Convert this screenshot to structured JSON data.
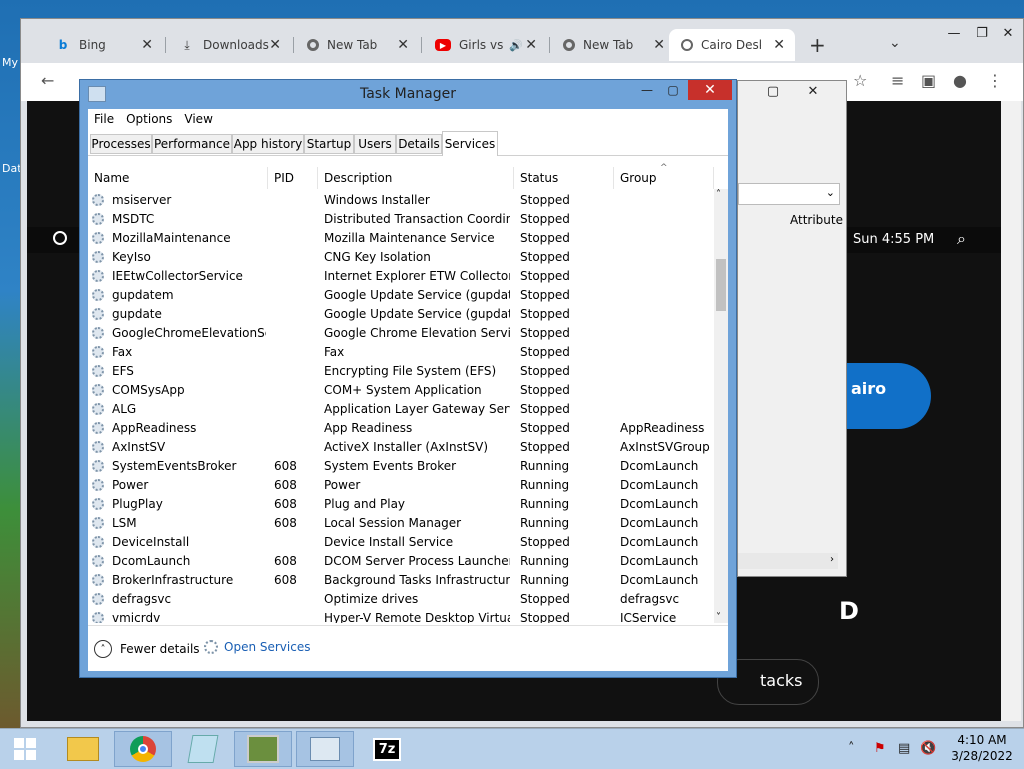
{
  "desktop": {
    "icon_labels": [
      "My",
      "Dat"
    ]
  },
  "chrome": {
    "tabs": [
      {
        "label": "Bing",
        "icon": "bing-icon"
      },
      {
        "label": "Downloads",
        "icon": "download-icon"
      },
      {
        "label": "New Tab",
        "icon": "chrome-icon"
      },
      {
        "label": "Girls vs",
        "icon": "youtube-icon"
      },
      {
        "label": "New Tab",
        "icon": "chrome-icon"
      },
      {
        "label": "Cairo Deskt",
        "icon": "cairo-icon"
      }
    ],
    "close_glyph": "✕",
    "newtab_glyph": "+",
    "page": {
      "time": "Sun 4:55 PM",
      "button_text": "airo",
      "heading_partial": "D",
      "pill_text": "tacks"
    }
  },
  "bgwindow": {
    "header_col": "Attribute"
  },
  "taskmanager": {
    "title": "Task Manager",
    "menu": [
      "File",
      "Options",
      "View"
    ],
    "tabs": [
      "Processes",
      "Performance",
      "App history",
      "Startup",
      "Users",
      "Details",
      "Services"
    ],
    "active_tab": "Services",
    "columns": [
      "Name",
      "PID",
      "Description",
      "Status",
      "Group"
    ],
    "rows": [
      {
        "name": "msiserver",
        "pid": "",
        "desc": "Windows Installer",
        "status": "Stopped",
        "group": ""
      },
      {
        "name": "MSDTC",
        "pid": "",
        "desc": "Distributed Transaction Coordin...",
        "status": "Stopped",
        "group": ""
      },
      {
        "name": "MozillaMaintenance",
        "pid": "",
        "desc": "Mozilla Maintenance Service",
        "status": "Stopped",
        "group": ""
      },
      {
        "name": "KeyIso",
        "pid": "",
        "desc": "CNG Key Isolation",
        "status": "Stopped",
        "group": ""
      },
      {
        "name": "IEEtwCollectorService",
        "pid": "",
        "desc": "Internet Explorer ETW Collector S...",
        "status": "Stopped",
        "group": ""
      },
      {
        "name": "gupdatem",
        "pid": "",
        "desc": "Google Update Service (gupdate...",
        "status": "Stopped",
        "group": ""
      },
      {
        "name": "gupdate",
        "pid": "",
        "desc": "Google Update Service (gupdate)",
        "status": "Stopped",
        "group": ""
      },
      {
        "name": "GoogleChromeElevationSer...",
        "pid": "",
        "desc": "Google Chrome Elevation Servic...",
        "status": "Stopped",
        "group": ""
      },
      {
        "name": "Fax",
        "pid": "",
        "desc": "Fax",
        "status": "Stopped",
        "group": ""
      },
      {
        "name": "EFS",
        "pid": "",
        "desc": "Encrypting File System (EFS)",
        "status": "Stopped",
        "group": ""
      },
      {
        "name": "COMSysApp",
        "pid": "",
        "desc": "COM+ System Application",
        "status": "Stopped",
        "group": ""
      },
      {
        "name": "ALG",
        "pid": "",
        "desc": "Application Layer Gateway Service",
        "status": "Stopped",
        "group": ""
      },
      {
        "name": "AppReadiness",
        "pid": "",
        "desc": "App Readiness",
        "status": "Stopped",
        "group": "AppReadiness"
      },
      {
        "name": "AxInstSV",
        "pid": "",
        "desc": "ActiveX Installer (AxInstSV)",
        "status": "Stopped",
        "group": "AxInstSVGroup"
      },
      {
        "name": "SystemEventsBroker",
        "pid": "608",
        "desc": "System Events Broker",
        "status": "Running",
        "group": "DcomLaunch"
      },
      {
        "name": "Power",
        "pid": "608",
        "desc": "Power",
        "status": "Running",
        "group": "DcomLaunch"
      },
      {
        "name": "PlugPlay",
        "pid": "608",
        "desc": "Plug and Play",
        "status": "Running",
        "group": "DcomLaunch"
      },
      {
        "name": "LSM",
        "pid": "608",
        "desc": "Local Session Manager",
        "status": "Running",
        "group": "DcomLaunch"
      },
      {
        "name": "DeviceInstall",
        "pid": "",
        "desc": "Device Install Service",
        "status": "Stopped",
        "group": "DcomLaunch"
      },
      {
        "name": "DcomLaunch",
        "pid": "608",
        "desc": "DCOM Server Process Launcher",
        "status": "Running",
        "group": "DcomLaunch"
      },
      {
        "name": "BrokerInfrastructure",
        "pid": "608",
        "desc": "Background Tasks Infrastructure ...",
        "status": "Running",
        "group": "DcomLaunch"
      },
      {
        "name": "defragsvc",
        "pid": "",
        "desc": "Optimize drives",
        "status": "Stopped",
        "group": "defragsvc"
      },
      {
        "name": "vmicrdv",
        "pid": "",
        "desc": "Hyper-V Remote Desktop Virtual...",
        "status": "Stopped",
        "group": "ICService"
      }
    ],
    "footer": {
      "fewer_details": "Fewer details",
      "open_services": "Open Services"
    }
  },
  "taskbar": {
    "icons": [
      "start-icon",
      "file-explorer-icon",
      "chrome-icon",
      "notepad-icon",
      "photo-icon",
      "task-manager-icon",
      "7zip-icon"
    ],
    "sevenzip_label": "7z",
    "clock_time": "4:10 AM",
    "clock_date": "3/28/2022"
  },
  "colors": {
    "accent": "#1a5fb4",
    "tm_frame": "#6fa3d9",
    "close_red": "#c7302b",
    "page_button": "#1170c8"
  }
}
